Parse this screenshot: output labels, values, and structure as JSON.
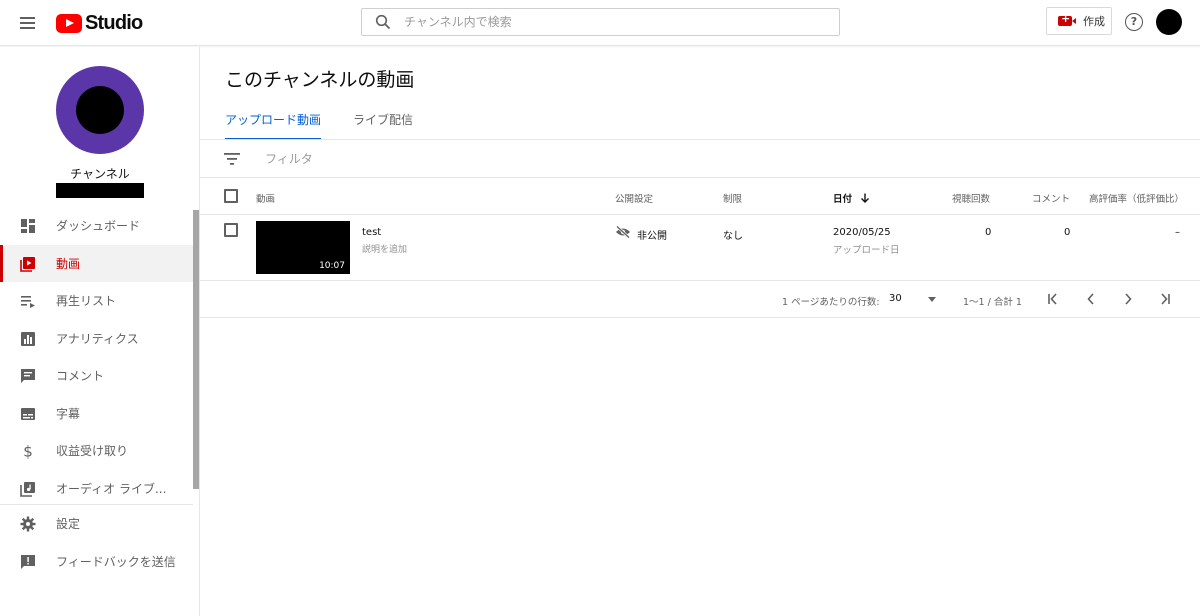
{
  "header": {
    "logo_text": "Studio",
    "search_placeholder": "チャンネル内で検索",
    "create_label": "作成",
    "help_glyph": "?"
  },
  "sidebar": {
    "channel_name": "チャンネル",
    "items": [
      {
        "label": "ダッシュボード",
        "icon": "dashboard-icon",
        "active": false
      },
      {
        "label": "動画",
        "icon": "videos-icon",
        "active": true
      },
      {
        "label": "再生リスト",
        "icon": "playlist-icon",
        "active": false
      },
      {
        "label": "アナリティクス",
        "icon": "analytics-icon",
        "active": false
      },
      {
        "label": "コメント",
        "icon": "comments-icon",
        "active": false
      },
      {
        "label": "字幕",
        "icon": "subtitles-icon",
        "active": false
      },
      {
        "label": "収益受け取り",
        "icon": "dollar-icon",
        "active": false
      },
      {
        "label": "オーディオ ライブ...",
        "icon": "audio-library-icon",
        "active": false
      }
    ],
    "bottom_items": [
      {
        "label": "設定",
        "icon": "gear-icon"
      },
      {
        "label": "フィードバックを送信",
        "icon": "feedback-icon"
      }
    ]
  },
  "main": {
    "title": "このチャンネルの動画",
    "tabs": [
      {
        "label": "アップロード動画",
        "active": true
      },
      {
        "label": "ライブ配信",
        "active": false
      }
    ],
    "filter_placeholder": "フィルタ",
    "columns": {
      "video": "動画",
      "visibility": "公開設定",
      "restrictions": "制限",
      "date": "日付",
      "views": "視聴回数",
      "comments": "コメント",
      "likes": "高評価率（低評価比）"
    },
    "rows": [
      {
        "title": "test",
        "description": "説明を追加",
        "duration": "10:07",
        "visibility": "非公開",
        "restrictions": "なし",
        "date": "2020/05/25",
        "date_sub": "アップロード日",
        "views": "0",
        "comments": "0",
        "likes": "–"
      }
    ],
    "pagination": {
      "rows_per_page_label": "1 ページあたりの行数:",
      "rows_per_page": "30",
      "range": "1～1 / 合計 1"
    }
  },
  "colors": {
    "accent_red": "#cc0000",
    "tab_blue": "#065fd4",
    "channel_avatar_purple": "#5b36a8"
  }
}
